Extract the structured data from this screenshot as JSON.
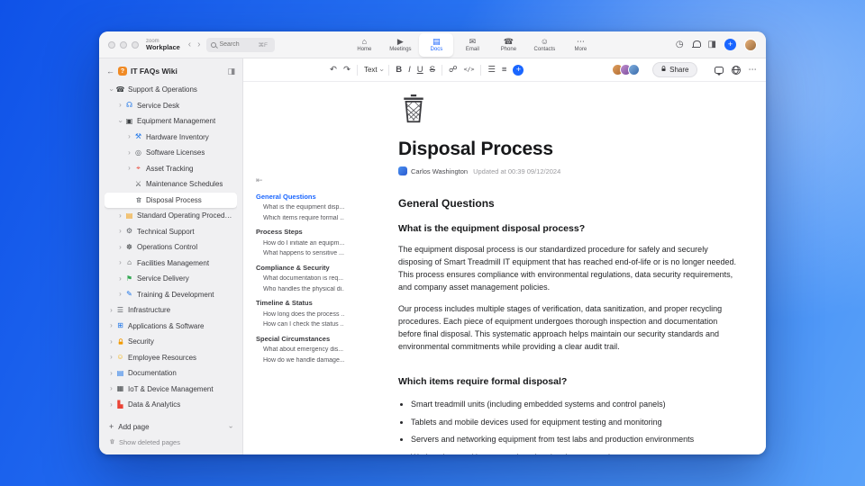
{
  "colors": {
    "accent": "#1a66ff",
    "wiki_badge": "#f08a24"
  },
  "icons": {
    "undo": "↶",
    "redo": "↷",
    "chevron": "›",
    "link": "☍",
    "code": "</>",
    "bullet_list": "☰",
    "align_left": "≡",
    "more": "⋯",
    "history": "◷",
    "panel": "◨",
    "plus": "+",
    "add": "+",
    "collapse": "⇤",
    "back": "←",
    "bold": "B",
    "italic": "I",
    "underline": "U",
    "strikethrough": "S",
    "nav_back": "‹",
    "nav_forward": "›",
    "wiki_badge": "?"
  },
  "titlebar": {
    "logo_top": "zoom",
    "logo_bottom": "Workplace",
    "search": {
      "placeholder": "Search",
      "shortcut": "⌘F"
    },
    "nav": [
      {
        "label": "Home",
        "icon": "home-icon",
        "glyph": "⌂",
        "active": false
      },
      {
        "label": "Meetings",
        "icon": "meetings-icon",
        "glyph": "▶",
        "active": false
      },
      {
        "label": "Docs",
        "icon": "docs-icon",
        "glyph": "▤",
        "active": true
      },
      {
        "label": "Email",
        "icon": "email-icon",
        "glyph": "✉",
        "active": false
      },
      {
        "label": "Phone",
        "icon": "phone-icon",
        "glyph": "☎",
        "active": false
      },
      {
        "label": "Contacts",
        "icon": "contacts-icon",
        "glyph": "☺",
        "active": false
      },
      {
        "label": "More",
        "icon": "more-icon",
        "glyph": "⋯",
        "active": false
      }
    ]
  },
  "sidebar": {
    "title": "IT FAQs Wiki",
    "add_page_label": "Add page",
    "show_deleted_label": "Show deleted pages",
    "tree": [
      {
        "label": "Support & Operations",
        "level": 0,
        "chevron": "down",
        "icon": "phone-icon",
        "glyph": "☎",
        "color": "#3c4043"
      },
      {
        "label": "Service Desk",
        "level": 1,
        "chevron": "right",
        "icon": "headset-icon",
        "glyph": "☊",
        "color": "#1a73e8"
      },
      {
        "label": "Equipment Management",
        "level": 1,
        "chevron": "down",
        "icon": "monitor-icon",
        "glyph": "▣",
        "color": "#3c4043"
      },
      {
        "label": "Hardware Inventory",
        "level": 2,
        "chevron": "right",
        "icon": "tools-icon",
        "glyph": "⚒",
        "color": "#1a73e8"
      },
      {
        "label": "Software Licenses",
        "level": 2,
        "chevron": "right",
        "icon": "disc-icon",
        "glyph": "◎",
        "color": "#5f6368"
      },
      {
        "label": "Asset Tracking",
        "level": 2,
        "chevron": "right",
        "icon": "pin-icon",
        "glyph": "⌖",
        "color": "#ea4335"
      },
      {
        "label": "Maintenance Schedules",
        "level": 2,
        "chevron": null,
        "icon": "crossed-tools-icon",
        "glyph": "⚔",
        "color": "#3c4043"
      },
      {
        "label": "Disposal Process",
        "level": 2,
        "chevron": null,
        "icon": "trash-icon",
        "glyph": "svg:trash",
        "color": "#5f6368",
        "selected": true
      },
      {
        "label": "Standard Operating Procedures",
        "level": 1,
        "chevron": "right",
        "icon": "book-icon",
        "glyph": "▤",
        "color": "#f29900"
      },
      {
        "label": "Technical Support",
        "level": 1,
        "chevron": "right",
        "icon": "wrench-icon",
        "glyph": "⚙",
        "color": "#5f6368"
      },
      {
        "label": "Operations Control",
        "level": 1,
        "chevron": "right",
        "icon": "control-knobs-icon",
        "glyph": "☸",
        "color": "#3c4043"
      },
      {
        "label": "Facilities Management",
        "level": 1,
        "chevron": "right",
        "icon": "building-icon",
        "glyph": "⌂",
        "color": "#3c4043"
      },
      {
        "label": "Service Delivery",
        "level": 1,
        "chevron": "right",
        "icon": "truck-icon",
        "glyph": "⚑",
        "color": "#34a853"
      },
      {
        "label": "Training & Development",
        "level": 1,
        "chevron": "right",
        "icon": "graduation-cap-icon",
        "glyph": "✎",
        "color": "#1a73e8"
      },
      {
        "label": "Infrastructure",
        "level": 0,
        "chevron": "right",
        "icon": "server-icon",
        "glyph": "☰",
        "color": "#5f6368"
      },
      {
        "label": "Applications & Software",
        "level": 0,
        "chevron": "right",
        "icon": "grid-icon",
        "glyph": "⊞",
        "color": "#1a73e8"
      },
      {
        "label": "Security",
        "level": 0,
        "chevron": "right",
        "icon": "lock-icon",
        "glyph": "svg:lock",
        "color": "#f29900"
      },
      {
        "label": "Employee Resources",
        "level": 0,
        "chevron": "right",
        "icon": "people-icon",
        "glyph": "☺",
        "color": "#f5b000"
      },
      {
        "label": "Documentation",
        "level": 0,
        "chevron": "right",
        "icon": "document-icon",
        "glyph": "▤",
        "color": "#1a73e8"
      },
      {
        "label": "IoT & Device Management",
        "level": 0,
        "chevron": "right",
        "icon": "device-icon",
        "glyph": "▦",
        "color": "#3c4043"
      },
      {
        "label": "Data & Analytics",
        "level": 0,
        "chevron": "right",
        "icon": "chart-icon",
        "glyph": "▙",
        "color": "#ea4335"
      }
    ]
  },
  "outline": {
    "items": [
      {
        "label": "General Questions",
        "type": "section",
        "active": true
      },
      {
        "label": "What is the equipment disp...",
        "type": "item"
      },
      {
        "label": "Which items require formal ...",
        "type": "item"
      },
      {
        "label": "Process Steps",
        "type": "section"
      },
      {
        "label": "How do I initiate an equipm...",
        "type": "item"
      },
      {
        "label": "What happens to sensitive ...",
        "type": "item"
      },
      {
        "label": "Compliance & Security",
        "type": "section"
      },
      {
        "label": "What documentation is req...",
        "type": "item"
      },
      {
        "label": "Who handles the physical di...",
        "type": "item"
      },
      {
        "label": "Timeline & Status",
        "type": "section"
      },
      {
        "label": "How long does the process ...",
        "type": "item"
      },
      {
        "label": "How can I check the status ...",
        "type": "item"
      },
      {
        "label": "Special Circumstances",
        "type": "section"
      },
      {
        "label": "What about emergency dis...",
        "type": "item"
      },
      {
        "label": "How do we handle damage...",
        "type": "item"
      }
    ]
  },
  "toolbar": {
    "text_style_label": "Text",
    "share_label": "Share",
    "avatar_count": 3
  },
  "doc": {
    "title": "Disposal Process",
    "author": "Carlos Washington",
    "updated_label": "Updated at 00:39 09/12/2024",
    "heading": "General Questions",
    "question1": "What is the equipment disposal process?",
    "para1": "The equipment disposal process is our standardized procedure for safely and securely disposing of Smart Treadmill IT equipment that has reached end-of-life or is no longer needed. This process ensures compliance with environmental regulations, data security requirements, and company asset management policies.",
    "para2": "Our process includes multiple stages of verification, data sanitization, and proper recycling procedures. Each piece of equipment undergoes thorough inspection and documentation before final disposal. This systematic approach helps maintain our security standards and environmental commitments while providing a clear audit trail.",
    "question2": "Which items require formal disposal?",
    "bullets": [
      "Smart treadmill units (including embedded systems and control panels)",
      "Tablets and mobile devices used for equipment testing and monitoring",
      "Servers and networking equipment from test labs and production environments",
      "Workstations and laptops assigned to development and support teams"
    ]
  }
}
